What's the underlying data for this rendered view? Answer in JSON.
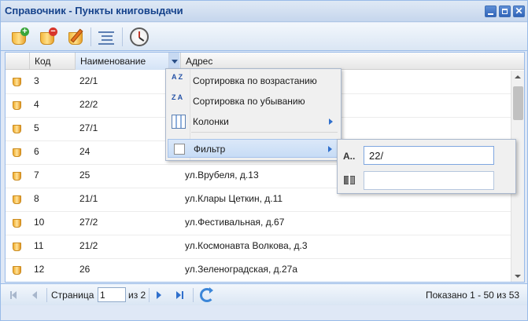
{
  "window": {
    "title": "Справочник - Пункты книговыдачи",
    "controls": {
      "minimize": "minimize",
      "maximize": "maximize",
      "close": "✕"
    }
  },
  "toolbar": {
    "buttons": [
      {
        "icon": "add-record-icon",
        "badge": "+"
      },
      {
        "icon": "delete-record-icon",
        "badge": "−"
      },
      {
        "icon": "edit-record-icon"
      },
      {
        "icon": "list-view-icon"
      },
      {
        "icon": "history-clock-icon"
      }
    ]
  },
  "grid": {
    "columns": {
      "code": "Код",
      "name": "Наименование",
      "address": "Адрес"
    },
    "rows": [
      {
        "code": "3",
        "name": "22/1",
        "address": ""
      },
      {
        "code": "4",
        "name": "22/2",
        "address": ""
      },
      {
        "code": "5",
        "name": "27/1",
        "address": ""
      },
      {
        "code": "6",
        "name": "24",
        "address": ""
      },
      {
        "code": "7",
        "name": "25",
        "address": "ул.Врубеля, д.13"
      },
      {
        "code": "8",
        "name": "21/1",
        "address": "ул.Клары Цеткин, д.11"
      },
      {
        "code": "10",
        "name": "27/2",
        "address": "ул.Фестивальная, д.67"
      },
      {
        "code": "11",
        "name": "21/2",
        "address": "ул.Космонавта Волкова, д.3"
      },
      {
        "code": "12",
        "name": "26",
        "address": "ул.Зеленоградская, д.27а"
      }
    ]
  },
  "column_menu": {
    "sort_asc": "Сортировка по возрастанию",
    "sort_desc": "Сортировка по убыванию",
    "columns": "Колонки",
    "filter": "Фильтр",
    "sort_asc_icon": "A Z",
    "sort_desc_icon": "Z A"
  },
  "filter_menu": {
    "text_icon": "A..",
    "text_value": "22/",
    "second_value": ""
  },
  "pager": {
    "page_label": "Страница",
    "page_value": "1",
    "of_label": "из 2",
    "summary": "Показано 1 - 50 из 53"
  },
  "colors": {
    "accent": "#15428b",
    "border": "#99bbe8",
    "toolbar_bg": "#dae6f4"
  }
}
